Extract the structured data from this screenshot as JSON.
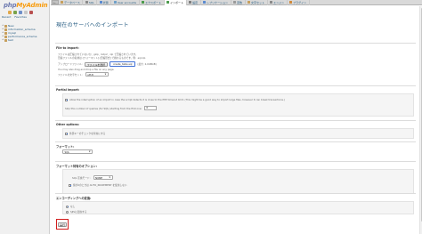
{
  "logo": {
    "part1": "php",
    "part2": "MyAdmin"
  },
  "nav": {
    "icon_colors": [
      "#e0a84b",
      "#7aa34a",
      "#6f8fc9",
      "#c8c8c8",
      "#b84f4f"
    ],
    "tabs": [
      "Recent",
      "Favorites"
    ],
    "databases": [
      {
        "expander": "+",
        "name": "New"
      },
      {
        "expander": "+",
        "name": "information_schema"
      },
      {
        "expander": "+",
        "name": "mysql"
      },
      {
        "expander": "+",
        "name": "performance_schema"
      },
      {
        "expander": "+",
        "name": "test"
      }
    ]
  },
  "topbar": {
    "back_label": "←",
    "tabs": [
      {
        "label": "データベース",
        "icon_color": "#c79f5c",
        "active": false
      },
      {
        "label": "SQL",
        "icon_color": "#8a8a8a",
        "active": false
      },
      {
        "label": "状態",
        "icon_color": "#5a8ad0",
        "active": false
      },
      {
        "label": "User accounts",
        "icon_color": "#6fa0c8",
        "active": false
      },
      {
        "label": "エクスポート",
        "icon_color": "#4c9b4c",
        "active": false
      },
      {
        "label": "インポート",
        "icon_color": "#4c9b4c",
        "active": true
      },
      {
        "label": "設定",
        "icon_color": "#7d7d7d",
        "active": false
      },
      {
        "label": "レプリケーション",
        "icon_color": "#5a8ad0",
        "active": false
      },
      {
        "label": "変数",
        "icon_color": "#9a9a9a",
        "active": false
      },
      {
        "label": "文字セット",
        "icon_color": "#c79f5c",
        "active": false
      },
      {
        "label": "エンジン",
        "icon_color": "#8a8a8a",
        "active": false
      },
      {
        "label": "プラグイン",
        "icon_color": "#d08a3a",
        "active": false
      }
    ]
  },
  "page_title": "現在のサーバへのインポート",
  "file": {
    "heading": "File to import:",
    "desc1": "ファイルは圧縮されていないか、gzip、bzip2、zip で圧縮されています。",
    "desc2": "圧縮ファイルの名前は.[フォーマット].[圧縮形式] で終わるものです。例: .sql.zip",
    "browse_label": "アップロードファイル:",
    "browse_button": "ファイルを選択",
    "chosen_file": "create_table.sql",
    "max_size": "(最大: 2,048KiB)",
    "drag_hint": "You may also drag and drop a file on any page.",
    "charset_label": "ファイルの文字セット:",
    "charset_value": "utf-8"
  },
  "partial": {
    "heading": "Partial import:",
    "allow_text": "Allow the interruption of an import in case the script detects it is close to the PHP timeout limit. (This might be a good way to import large files, however it can break transactions.)",
    "allow_checked": true,
    "skip_text": "Skip this number of queries (for SQL) starting from the first one:",
    "skip_value": "0"
  },
  "other": {
    "heading": "Other options:",
    "fk_text": "外部キーのチェックを有効にする",
    "fk_checked": true
  },
  "format": {
    "heading": "フォーマット:",
    "value": "SQL"
  },
  "format_options": {
    "heading": "フォーマット特有のオプション:",
    "compat_label": "SQL 互換モード:",
    "compat_value": "NONE",
    "autoinc_text": "値が0のときは AUTO_INCREMENT を使用しない",
    "autoinc_checked": true
  },
  "encoding": {
    "heading": "エンコーディングへの変換:",
    "none_label": "なし",
    "sjis_label": "SJISに変換する",
    "none_selected": true
  },
  "submit_label": "実行"
}
